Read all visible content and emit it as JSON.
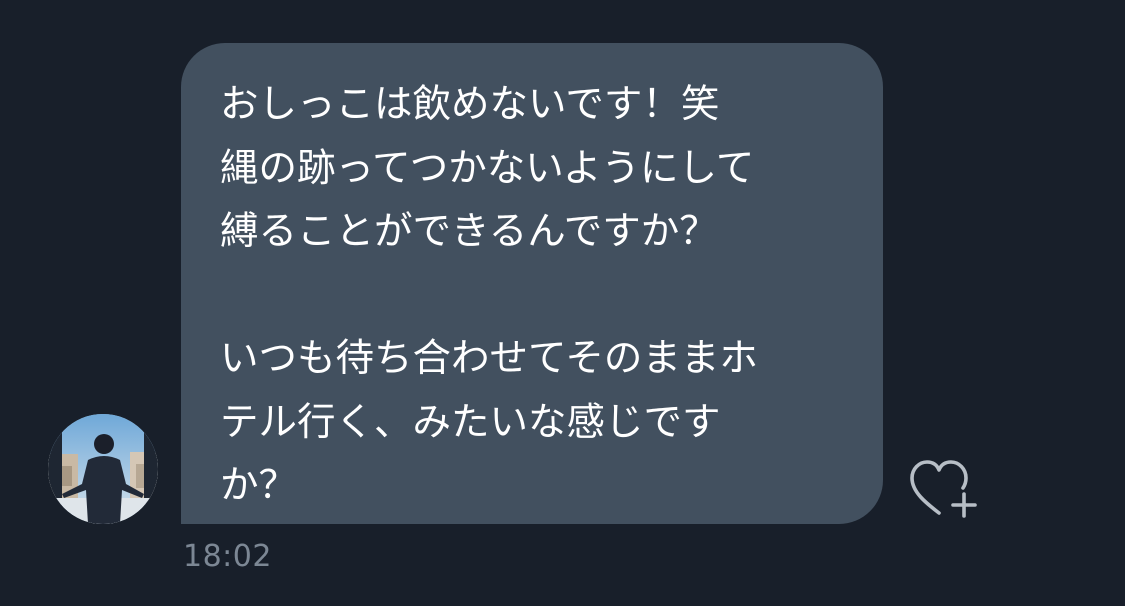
{
  "message": {
    "lines": [
      "おしっこは飲めないです！笑",
      "縄の跡ってつかないようにして",
      "縛ることができるんですか？",
      "",
      "いつも待ち合わせてそのままホ",
      "テル行く、みたいな感じです",
      "か？"
    ],
    "time": "18:02"
  },
  "icons": {
    "react": "heart-plus-icon",
    "avatar": "avatar"
  },
  "colors": {
    "background": "#181f2a",
    "bubble": "#42505f",
    "text": "#ffffff",
    "timestamp": "#7c8794",
    "icon": "#b7bec6"
  }
}
